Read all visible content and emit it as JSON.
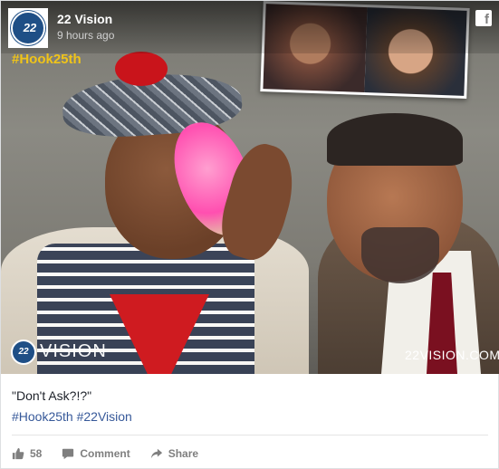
{
  "header": {
    "page_name": "22 Vision",
    "time": "9 hours ago",
    "avatar_text": "22",
    "fb_icon": "facebook-icon"
  },
  "photo": {
    "hashtag_overlay": "#Hook25th",
    "watermark_logo": "22",
    "watermark_text": "VISION",
    "watermark_site": "22VISION.COM"
  },
  "post": {
    "caption": "\"Don't Ask?!?\"",
    "hashtag_1": "#Hook25th",
    "hashtag_2": "#22Vision"
  },
  "actions": {
    "like_count": "58",
    "comment_label": "Comment",
    "share_label": "Share",
    "like_icon": "thumbs-up-icon",
    "comment_icon": "comment-icon",
    "share_icon": "share-arrow-icon"
  },
  "colors": {
    "link": "#365899",
    "hashtag_overlay": "#f0c419",
    "brand_blue": "#1f4f86",
    "action_gray": "#7f7f7f"
  }
}
